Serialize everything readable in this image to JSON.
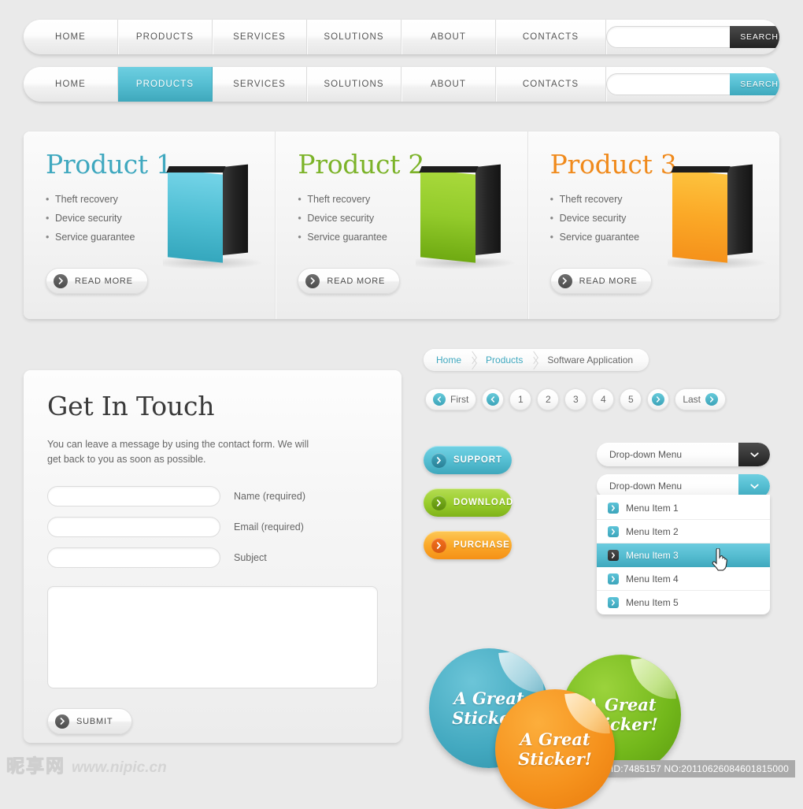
{
  "nav_top": {
    "items": [
      {
        "label": "HOME"
      },
      {
        "label": "PRODUCTS"
      },
      {
        "label": "SERVICES"
      },
      {
        "label": "SOLUTIONS"
      },
      {
        "label": "ABOUT"
      },
      {
        "label": "CONTACTS"
      }
    ],
    "search": {
      "value": "",
      "placeholder": "",
      "button_label": "SEARCH"
    }
  },
  "nav_second": {
    "items": [
      {
        "label": "HOME"
      },
      {
        "label": "PRODUCTS"
      },
      {
        "label": "SERVICES"
      },
      {
        "label": "SOLUTIONS"
      },
      {
        "label": "ABOUT"
      },
      {
        "label": "CONTACTS"
      }
    ],
    "active_index": 1,
    "search": {
      "value": "",
      "placeholder": "",
      "button_label": "SEARCH"
    }
  },
  "products": [
    {
      "title": "Product 1",
      "color": "#3fa8bf",
      "features": [
        "Theft recovery",
        "Device security",
        "Service guarantee"
      ],
      "button_label": "READ MORE"
    },
    {
      "title": "Product 2",
      "color": "#7cb329",
      "features": [
        "Theft recovery",
        "Device security",
        "Service guarantee"
      ],
      "button_label": "READ MORE"
    },
    {
      "title": "Product 3",
      "color": "#f08a1c",
      "features": [
        "Theft recovery",
        "Device security",
        "Service guarantee"
      ],
      "button_label": "READ MORE"
    }
  ],
  "contact": {
    "title": "Get In Touch",
    "description": "You can leave a message by using the contact form. We will get back to you as soon as possible.",
    "fields": [
      {
        "value": "",
        "placeholder": "",
        "label": "Name (required)"
      },
      {
        "value": "",
        "placeholder": "",
        "label": "Email (required)"
      },
      {
        "value": "",
        "placeholder": "",
        "label": "Subject"
      }
    ],
    "message": {
      "value": "",
      "placeholder": ""
    },
    "submit_label": "SUBMIT"
  },
  "breadcrumb": {
    "items": [
      {
        "label": "Home",
        "current": false
      },
      {
        "label": "Products",
        "current": false
      },
      {
        "label": "Software Application",
        "current": true
      }
    ]
  },
  "pagination": {
    "first_label": "First",
    "last_label": "Last",
    "pages": [
      "1",
      "2",
      "3",
      "4",
      "5"
    ],
    "active_page": null
  },
  "action_buttons": [
    {
      "label": "SUPPORT",
      "color": "#3ea7bc"
    },
    {
      "label": "DOWNLOAD",
      "color": "#7fb319"
    },
    {
      "label": "PURCHASE",
      "color": "#f59016"
    }
  ],
  "dropdowns": {
    "first": {
      "label": "Drop-down Menu"
    },
    "second": {
      "label": "Drop-down Menu"
    },
    "items": [
      {
        "label": "Menu Item 1"
      },
      {
        "label": "Menu Item 2"
      },
      {
        "label": "Menu Item 3"
      },
      {
        "label": "Menu Item 4"
      },
      {
        "label": "Menu Item 5"
      }
    ],
    "selected_index": 2
  },
  "stickers": [
    {
      "line1": "A Great",
      "line2": "Sticker!",
      "color": "#43a9c0"
    },
    {
      "line1": "A Great",
      "line2": "Sticker!",
      "color": "#73b81b"
    },
    {
      "line1": "A Great",
      "line2": "Sticker!",
      "color": "#f5911c"
    }
  ],
  "footer": {
    "watermark_cn": "昵享网",
    "watermark_url": "www.nipic.cn",
    "id_badge": "ID:7485157 NO:20110626084601815000"
  },
  "theme": {
    "accent_teal": "#3ea8bc",
    "accent_green": "#7fb319",
    "accent_orange": "#f59016",
    "page_bg": "#eaeaea"
  }
}
